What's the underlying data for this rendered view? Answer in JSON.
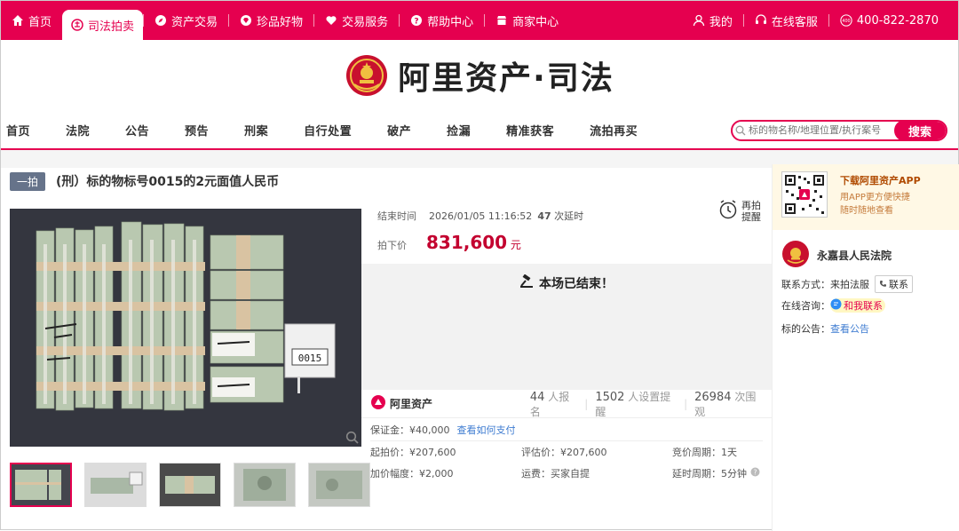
{
  "topnav": {
    "items": [
      {
        "label": "首页",
        "icon": "home-icon"
      },
      {
        "label": "司法拍卖",
        "icon": "court-emblem-icon",
        "active": true
      },
      {
        "label": "资产交易",
        "icon": "compass-icon"
      },
      {
        "label": "珍品好物",
        "icon": "diamond-icon"
      },
      {
        "label": "交易服务",
        "icon": "heart-icon"
      },
      {
        "label": "帮助中心",
        "icon": "question-icon"
      },
      {
        "label": "商家中心",
        "icon": "shop-icon"
      }
    ],
    "mine": "我的",
    "service": "在线客服",
    "phone": "400-822-2870"
  },
  "brand": {
    "name": "阿里资产·司法"
  },
  "menu": [
    "首页",
    "法院",
    "公告",
    "预告",
    "刑案",
    "自行处置",
    "破产",
    "捡漏",
    "精准获客",
    "流拍再买"
  ],
  "search": {
    "placeholder": "标的物名称/地理位置/执行案号",
    "button": "搜索"
  },
  "item": {
    "badge": "一拍",
    "title": "(刑）标的物标号0015的2元面值人民币",
    "end_label": "结束时间",
    "end_time": "2026/01/05 11:16:52",
    "delay_count": "47",
    "delay_suffix": "次延时",
    "rebid": "再拍提醒",
    "sold_label": "拍下价",
    "price": "831,600",
    "unit": "元",
    "ended": "本场已结束！"
  },
  "stats": {
    "brand": "阿里资产",
    "applicants": "44",
    "applicants_label": "人报名",
    "reminders": "1502",
    "reminders_label": "人设置提醒",
    "views": "26984",
    "views_label": "次围观"
  },
  "details": {
    "deposit": "保证金：¥40,000",
    "deposit_link": "查看如何支付",
    "start": "起拍价：¥207,600",
    "eval": "评估价：¥207,600",
    "cycle": "竞价周期：1天",
    "step": "加价幅度：¥2,000",
    "shipping": "运费：买家自提",
    "delay": "延时周期：5分钟"
  },
  "sidebar": {
    "app_title": "下载阿里资产APP",
    "app_sub1": "用APP更方便快捷",
    "app_sub2": "随时随地查看",
    "court": "永嘉县人民法院",
    "contact_label": "联系方式：",
    "contact_val": "来拍法服",
    "contact_btn": "联系",
    "consult_label": "在线咨询：",
    "consult_btn": "和我联系",
    "notice_label": "标的公告：",
    "notice_link": "查看公告"
  },
  "photo": {
    "card": "0015"
  },
  "colors": {
    "brand": "#e5004f",
    "price": "#c3002f",
    "link": "#3f7cd1"
  }
}
